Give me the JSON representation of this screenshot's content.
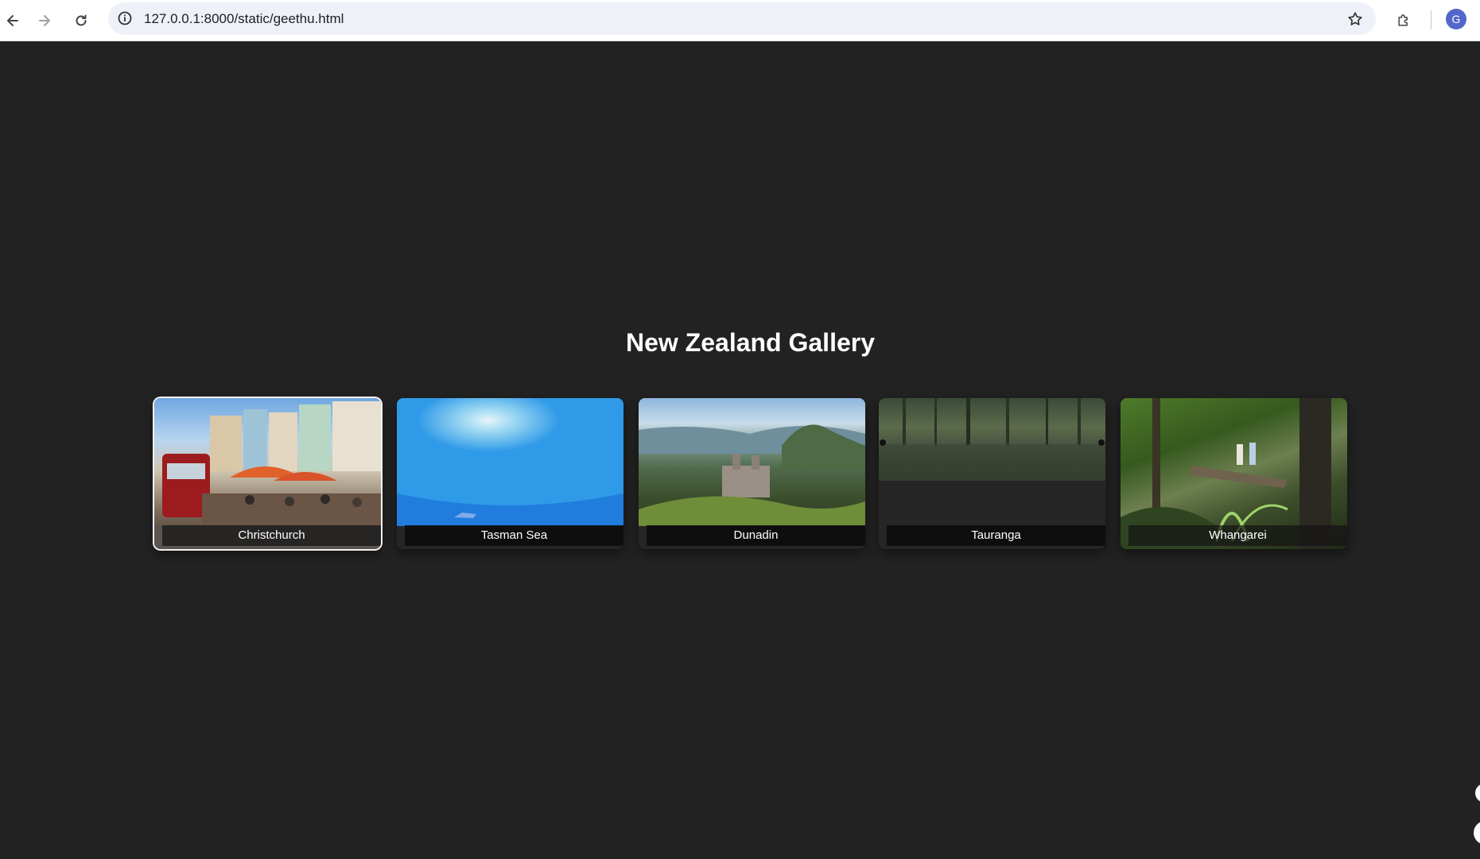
{
  "browser": {
    "url": "127.0.0.1:8000/static/geethu.html",
    "profile_initial": "G"
  },
  "page": {
    "title": "New Zealand Gallery"
  },
  "gallery": {
    "items": [
      {
        "caption": "Christchurch"
      },
      {
        "caption": "Tasman Sea"
      },
      {
        "caption": "Dunadin"
      },
      {
        "caption": "Tauranga"
      },
      {
        "caption": "Whangarei"
      }
    ]
  },
  "colors": {
    "background": "#222222",
    "caption_bg": "#0a0a0a",
    "text": "#ffffff"
  }
}
